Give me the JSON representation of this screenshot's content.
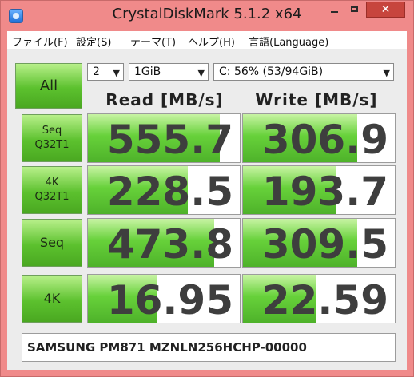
{
  "window": {
    "title": "CrystalDiskMark 5.1.2 x64",
    "close_glyph": "✕"
  },
  "menu": [
    {
      "label": "ファイル(F)"
    },
    {
      "label": "設定(S)"
    },
    {
      "label": "テーマ(T)"
    },
    {
      "label": "ヘルプ(H)"
    },
    {
      "label": "言語(Language)"
    }
  ],
  "controls": {
    "all_label": "All",
    "count": "2",
    "size": "1GiB",
    "drive": "C: 56% (53/94GiB)",
    "arrow_glyph": "▼"
  },
  "columns": {
    "read": "Read [MB/s]",
    "write": "Write [MB/s]"
  },
  "tests": [
    {
      "line1": "Seq",
      "line2": "Q32T1",
      "read": "555.7",
      "write": "306.9",
      "read_fill": 0.87,
      "write_fill": 0.75
    },
    {
      "line1": "4K",
      "line2": "Q32T1",
      "read": "228.5",
      "write": "193.7",
      "read_fill": 0.66,
      "write_fill": 0.61
    },
    {
      "line1": "Seq",
      "line2": "",
      "read": "473.8",
      "write": "309.5",
      "read_fill": 0.83,
      "write_fill": 0.75
    },
    {
      "line1": "4K",
      "line2": "",
      "read": "16.95",
      "write": "22.59",
      "read_fill": 0.45,
      "write_fill": 0.48
    }
  ],
  "footer": {
    "device": "SAMSUNG PM871 MZNLN256HCHP-00000"
  },
  "colors": {
    "frame": "#f08a8a",
    "accent_green": "#5cc12e",
    "close": "#c7453d"
  }
}
